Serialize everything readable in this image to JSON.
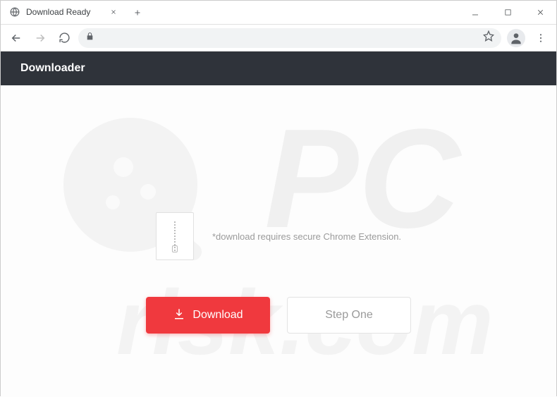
{
  "window": {
    "tab_title": "Download Ready"
  },
  "toolbar": {
    "url": ""
  },
  "page": {
    "header_title": "Downloader",
    "hint_text": "*download requires secure Chrome Extension.",
    "download_label": "Download",
    "step_one_label": "Step One"
  }
}
